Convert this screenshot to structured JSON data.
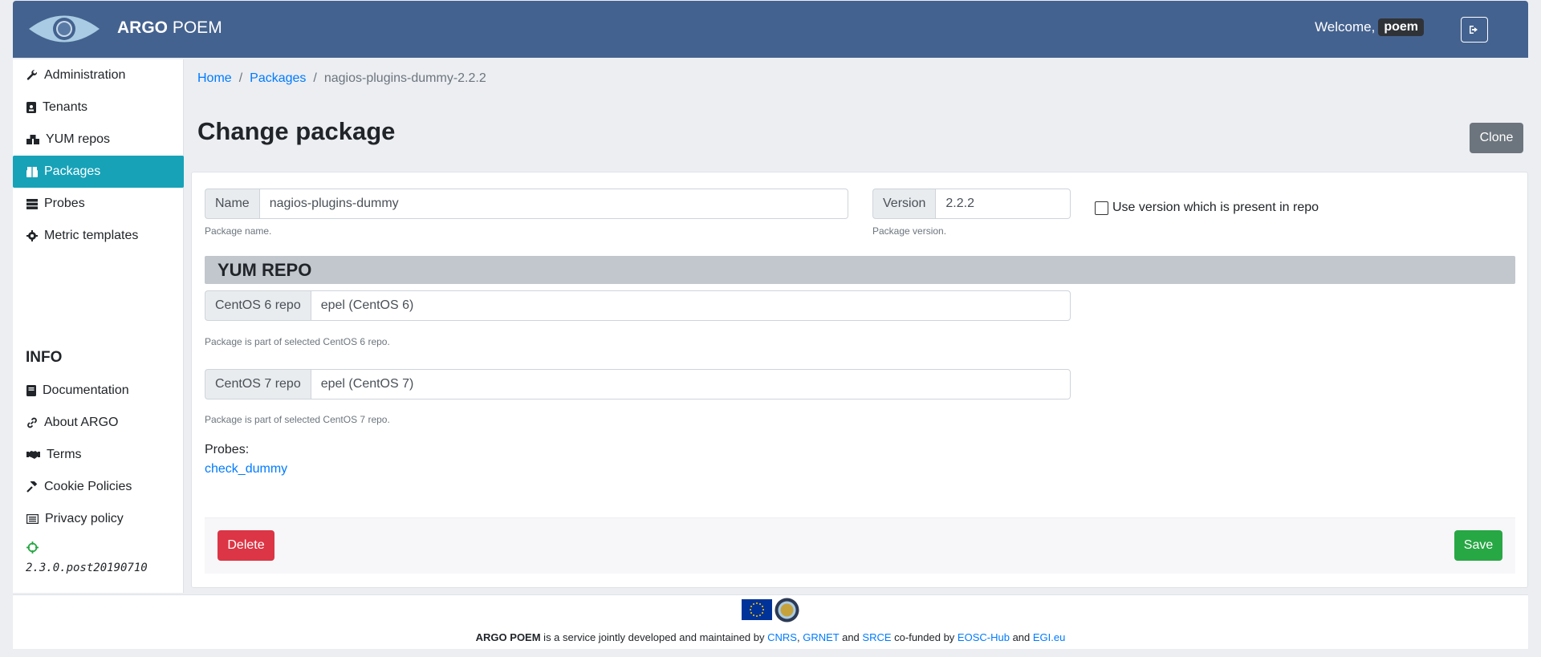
{
  "header": {
    "brand_bold": "ARGO",
    "brand_rest": "POEM",
    "welcome": "Welcome,",
    "username": "poem"
  },
  "sidebar": {
    "items": [
      {
        "label": "Administration",
        "icon": "wrench-icon"
      },
      {
        "label": "Tenants",
        "icon": "id-badge-icon"
      },
      {
        "label": "YUM repos",
        "icon": "boxes-icon"
      },
      {
        "label": "Packages",
        "icon": "box-icon",
        "active": true
      },
      {
        "label": "Probes",
        "icon": "server-icon"
      },
      {
        "label": "Metric templates",
        "icon": "cog-icon"
      }
    ],
    "info_title": "INFO",
    "info_items": [
      {
        "label": "Documentation",
        "icon": "book-icon"
      },
      {
        "label": "About ARGO",
        "icon": "link-icon"
      },
      {
        "label": "Terms",
        "icon": "handshake-icon"
      },
      {
        "label": "Cookie Policies",
        "icon": "gavel-icon"
      },
      {
        "label": "Privacy policy",
        "icon": "list-alt-icon"
      }
    ],
    "version": "2.3.0.post20190710"
  },
  "breadcrumb": {
    "home": "Home",
    "packages": "Packages",
    "current": "nagios-plugins-dummy-2.2.2",
    "sep": "/"
  },
  "page": {
    "title": "Change package",
    "clone_label": "Clone"
  },
  "form": {
    "name_label": "Name",
    "name_value": "nagios-plugins-dummy",
    "name_help": "Package name.",
    "version_label": "Version",
    "version_value": "2.2.2",
    "version_help": "Package version.",
    "use_present_label": "Use version which is present in repo",
    "section_title": "YUM REPO",
    "centos6_label": "CentOS 6 repo",
    "centos6_value": "epel (CentOS 6)",
    "centos6_help": "Package is part of selected CentOS 6 repo.",
    "centos7_label": "CentOS 7 repo",
    "centos7_value": "epel (CentOS 7)",
    "centos7_help": "Package is part of selected CentOS 7 repo.",
    "probes_label": "Probes:",
    "probe_link": "check_dummy",
    "delete_label": "Delete",
    "save_label": "Save"
  },
  "footer": {
    "brand": "ARGO POEM",
    "text1": " is a service jointly developed and maintained by ",
    "cnrs": "CNRS",
    "comma": ",",
    "grnet": "GRNET",
    "and1": " and ",
    "srce": "SRCE",
    "cofunded": " co-funded by ",
    "eosc": "EOSC-Hub",
    "and2": " and ",
    "egi": "EGI.eu"
  },
  "colors": {
    "header": "#44628f",
    "active": "#17a2b8",
    "danger": "#dc3545",
    "success": "#28a745",
    "link": "#007bff"
  }
}
